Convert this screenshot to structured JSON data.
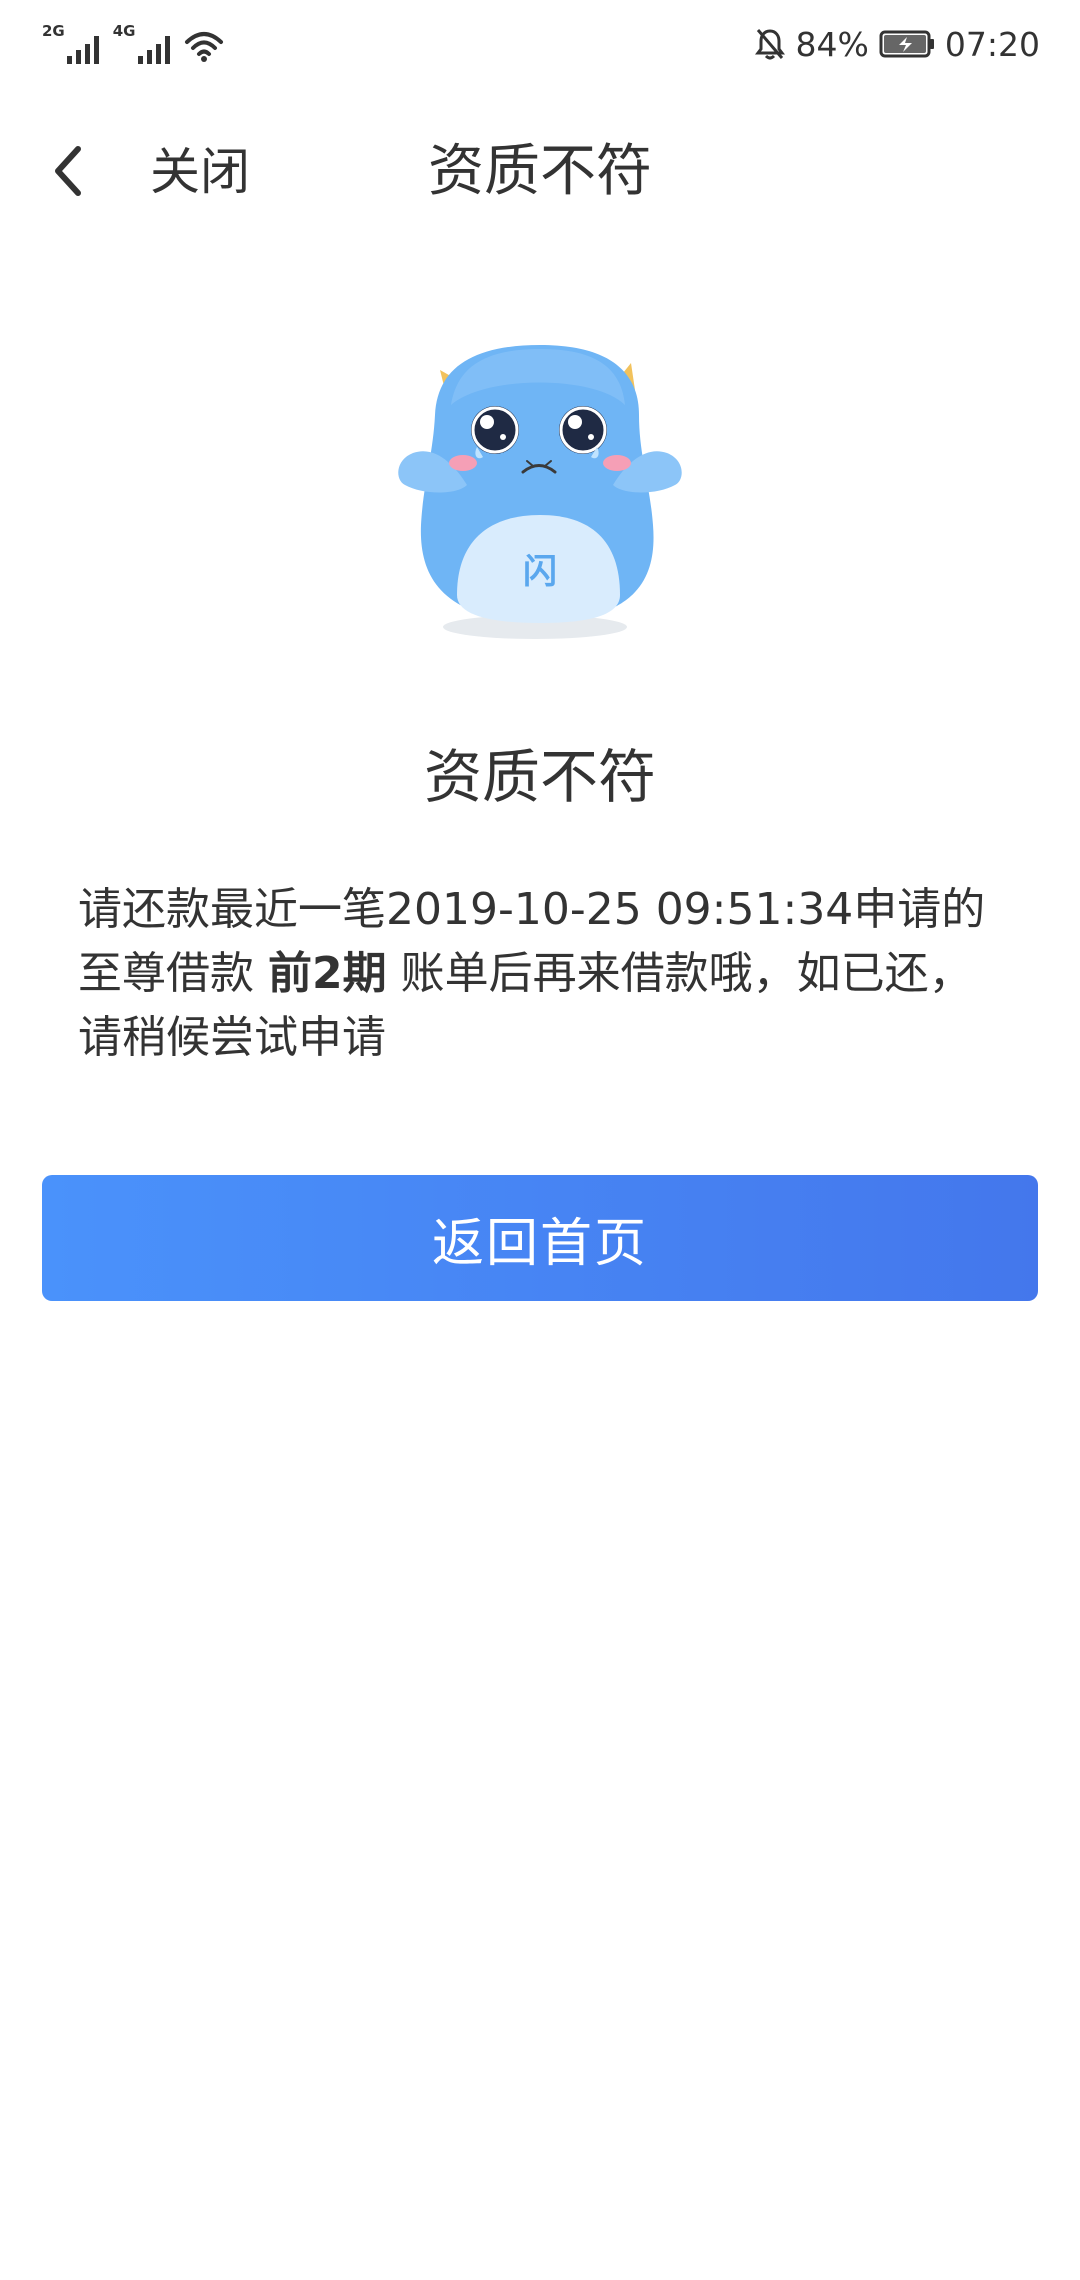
{
  "status_bar": {
    "net1_label": "2G",
    "net2_label": "4G",
    "battery_percent": "84%",
    "time": "07:20",
    "icons": [
      "signal-icon",
      "signal-icon",
      "wifi-icon",
      "bell-off-icon",
      "battery-charging-icon"
    ]
  },
  "nav": {
    "close_label": "关闭",
    "title": "资质不符",
    "back_icon": "chevron-left-icon"
  },
  "result": {
    "mascot": "crying-mascot-illustration",
    "mascot_badge": "闪",
    "title": "资质不符",
    "message_part1": "请还款最近一笔2019-10-25 09:51:34申请的至尊借款 ",
    "message_strong": "前2期",
    "message_part2": " 账单后再来借款哦，如已还，请稍候尝试申请"
  },
  "actions": {
    "home_button_label": "返回首页"
  },
  "colors": {
    "primary_gradient_start": "#4a92fb",
    "primary_gradient_end": "#4477ec",
    "mascot_blue": "#6fb5f5",
    "text": "#333333"
  }
}
